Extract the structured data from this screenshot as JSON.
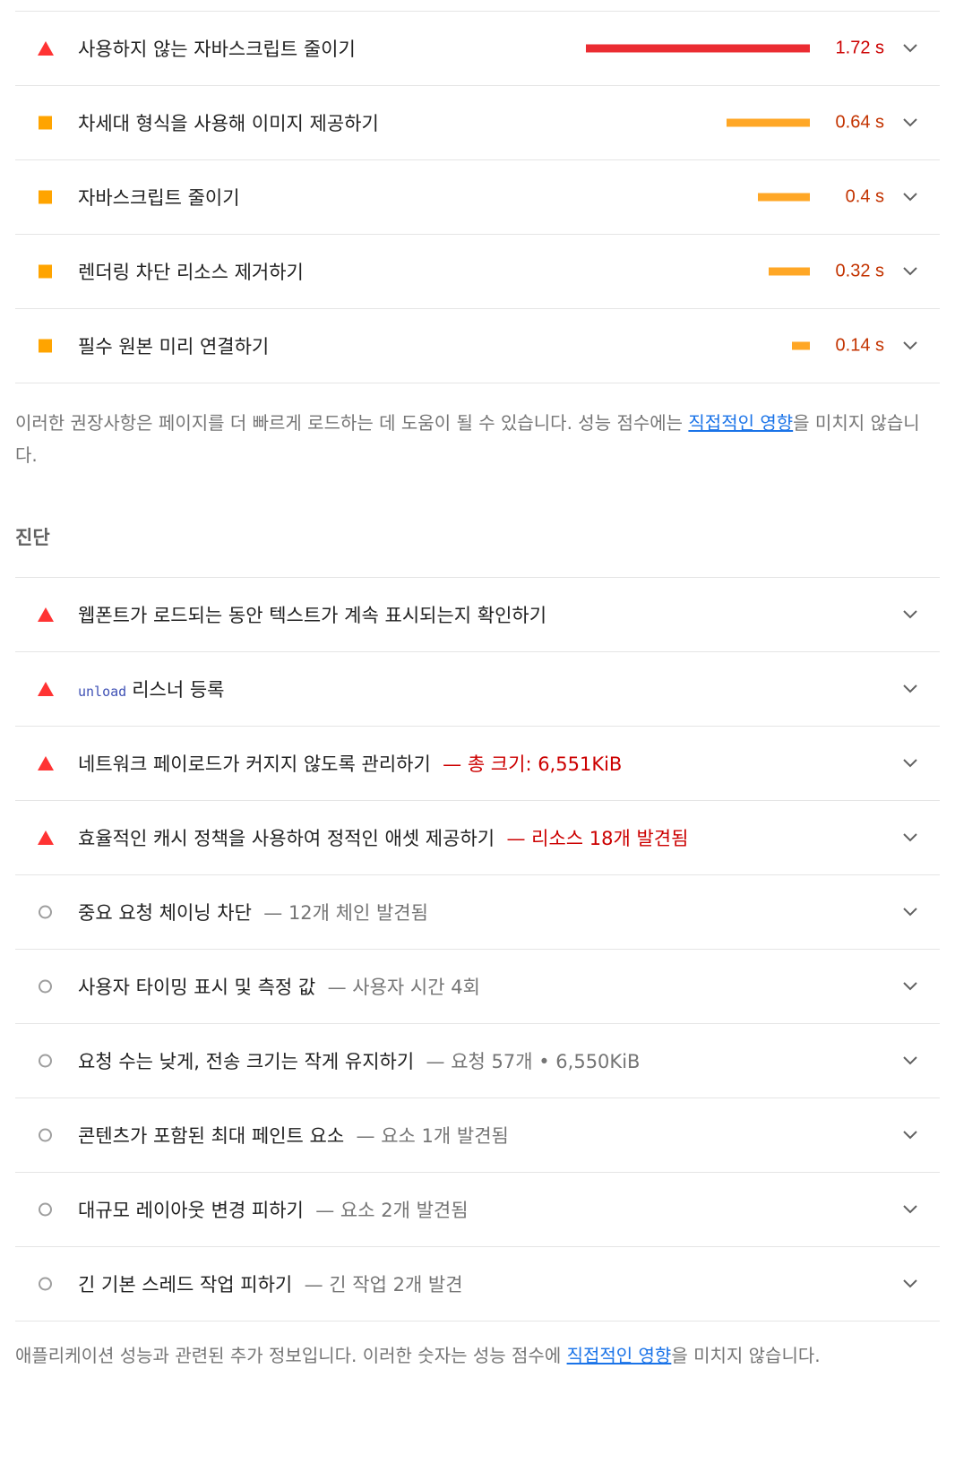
{
  "opportunities": [
    {
      "indicator": "fail",
      "title": "사용하지 않는 자바스크립트 줄이기",
      "bar_fraction": 1.0,
      "bar_class": "fail",
      "time": "1.72 s",
      "time_class": "fail"
    },
    {
      "indicator": "average",
      "title": "차세대 형식을 사용해 이미지 제공하기",
      "bar_fraction": 0.372,
      "bar_class": "avg",
      "time": "0.64 s",
      "time_class": "avg"
    },
    {
      "indicator": "average",
      "title": "자바스크립트 줄이기",
      "bar_fraction": 0.233,
      "bar_class": "avg",
      "time": "0.4 s",
      "time_class": "avg"
    },
    {
      "indicator": "average",
      "title": "렌더링 차단 리소스 제거하기",
      "bar_fraction": 0.186,
      "bar_class": "avg",
      "time": "0.32 s",
      "time_class": "avg"
    },
    {
      "indicator": "average",
      "title": "필수 원본 미리 연결하기",
      "bar_fraction": 0.081,
      "bar_class": "avg",
      "time": "0.14 s",
      "time_class": "avg"
    }
  ],
  "opportunity_note": {
    "text": "이러한 권장사항은 페이지를 더 빠르게 로드하는 데 도움이 될 수 있습니다. 성능 점수에는 ",
    "link": "직접적인 영향",
    "suffix": "을 미치지 않습니다."
  },
  "diagnostics_heading": "진단",
  "diagnostics": [
    {
      "indicator": "fail",
      "code": "",
      "title": "웹폰트가 로드되는 동안 텍스트가 계속 표시되는지 확인하기",
      "detail": "",
      "detail_class": ""
    },
    {
      "indicator": "fail",
      "code": "unload",
      "title": "리스너 등록",
      "detail": "",
      "detail_class": ""
    },
    {
      "indicator": "fail",
      "code": "",
      "title": "네트워크 페이로드가 커지지 않도록 관리하기",
      "detail": "— 총 크기: 6,551KiB",
      "detail_class": "fail"
    },
    {
      "indicator": "fail",
      "code": "",
      "title": "효율적인 캐시 정책을 사용하여 정적인 애셋 제공하기",
      "detail": "— 리소스 18개 발견됨",
      "detail_class": "fail"
    },
    {
      "indicator": "info",
      "code": "",
      "title": "중요 요청 체이닝 차단",
      "detail": "— 12개 체인 발견됨",
      "detail_class": "info"
    },
    {
      "indicator": "info",
      "code": "",
      "title": "사용자 타이밍 표시 및 측정 값",
      "detail": "— 사용자 시간 4회",
      "detail_class": "info"
    },
    {
      "indicator": "info",
      "code": "",
      "title": "요청 수는 낮게, 전송 크기는 작게 유지하기",
      "detail": "— 요청 57개 • 6,550KiB",
      "detail_class": "info"
    },
    {
      "indicator": "info",
      "code": "",
      "title": "콘텐츠가 포함된 최대 페인트 요소",
      "detail": "— 요소 1개 발견됨",
      "detail_class": "info"
    },
    {
      "indicator": "info",
      "code": "",
      "title": "대규모 레이아웃 변경 피하기",
      "detail": "— 요소 2개 발견됨",
      "detail_class": "info"
    },
    {
      "indicator": "info",
      "code": "",
      "title": "긴 기본 스레드 작업 피하기",
      "detail": "— 긴 작업 2개 발견",
      "detail_class": "info"
    }
  ],
  "diagnostics_note": {
    "text": "애플리케이션 성능과 관련된 추가 정보입니다. 이러한 숫자는 성능 점수에 ",
    "link": "직접적인 영향",
    "suffix": "을 미치지 않습니다."
  },
  "colors": {
    "fail": "#ff3333",
    "average": "#ffa400",
    "info": "#9e9e9e",
    "link": "#1a73e8"
  }
}
